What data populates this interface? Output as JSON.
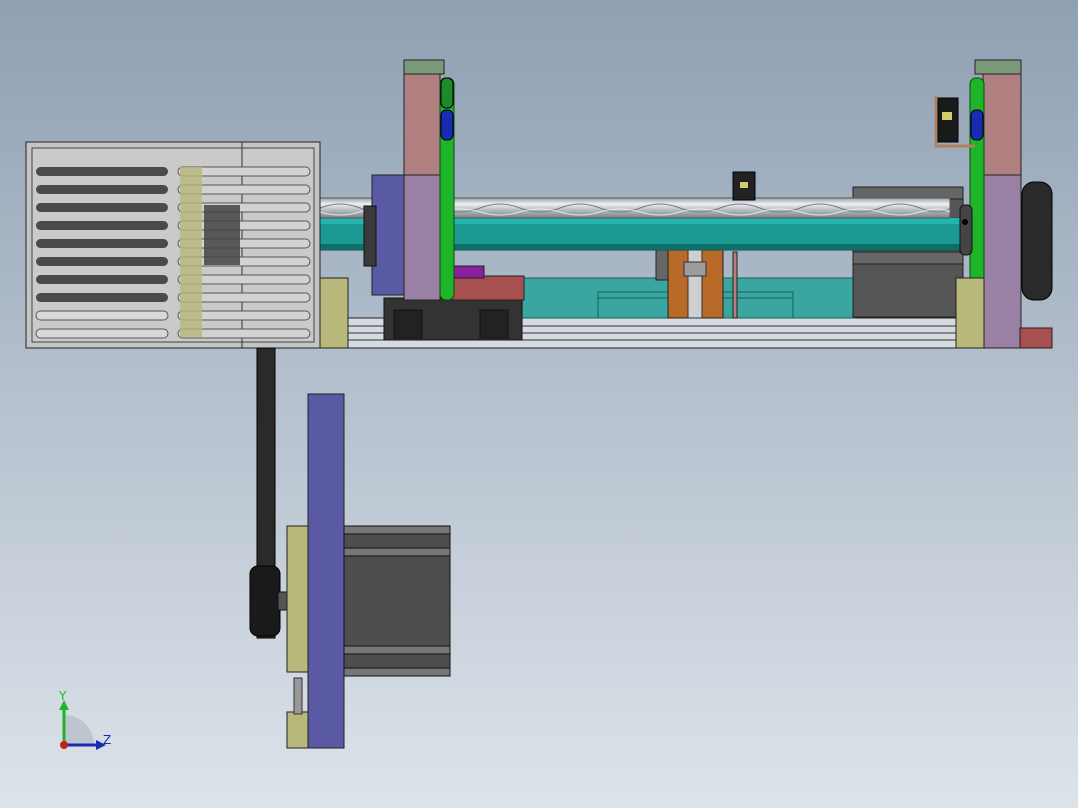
{
  "triad": {
    "y_label": "Y",
    "z_label": "Z"
  },
  "colors": {
    "bg_top": "#8fa0b3",
    "bg_bottom": "#dce2ea",
    "housing": "#c4c4c4",
    "slot": "#4a4a4a",
    "teal": "#1a9a92",
    "teal_dark": "#0e6f6a",
    "pink": "#b08080",
    "mauve": "#9a80a4",
    "green": "#1fb52a",
    "blue_part": "#5a5aa4",
    "olive": "#b8b87a",
    "dark": "#4e4e4e",
    "copper": "#b86a28",
    "magenta": "#8a1fa0",
    "red_brown": "#a85050"
  }
}
